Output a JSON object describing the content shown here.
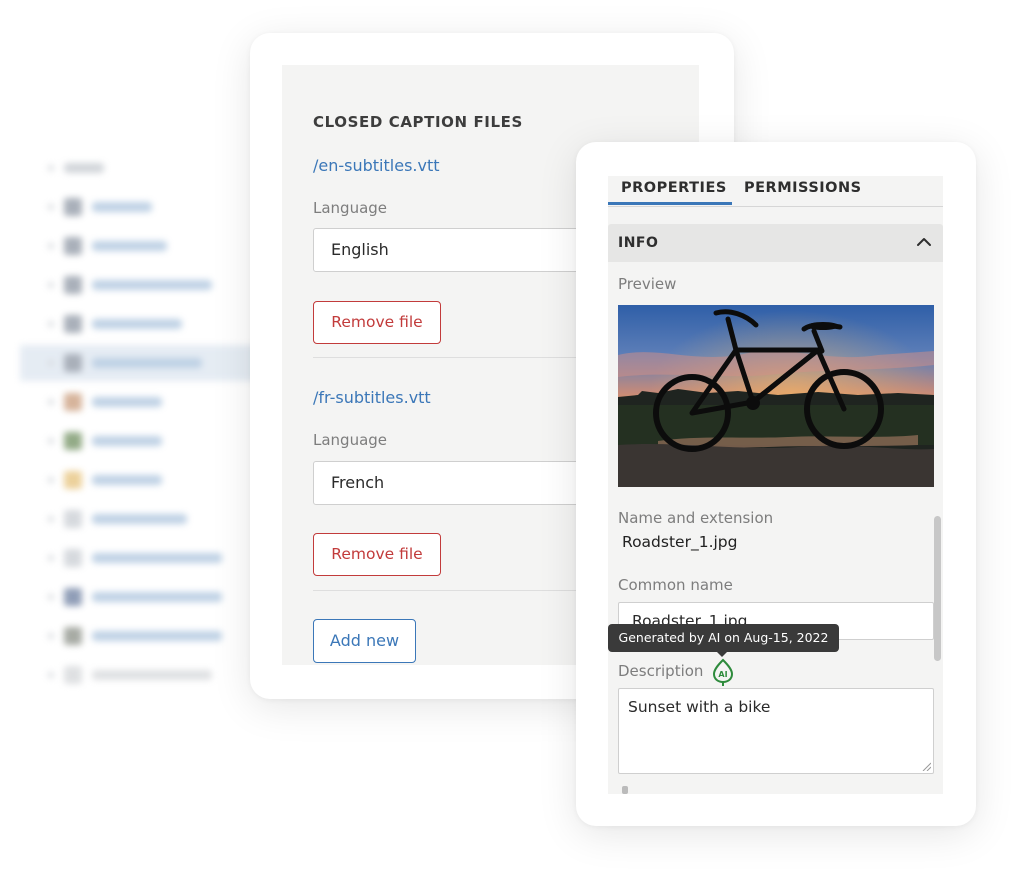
{
  "closed_captions": {
    "title": "CLOSED CAPTION FILES",
    "files": [
      {
        "name": "/en-subtitles.vtt",
        "language_label": "Language",
        "language_value": "English",
        "remove_label": "Remove file"
      },
      {
        "name": "/fr-subtitles.vtt",
        "language_label": "Language",
        "language_value": "French",
        "remove_label": "Remove file"
      }
    ],
    "add_label": "Add new"
  },
  "properties": {
    "tabs": [
      {
        "label": "PROPERTIES",
        "active": true
      },
      {
        "label": "PERMISSIONS",
        "active": false
      }
    ],
    "section": {
      "title": "INFO",
      "expanded": true,
      "icon": "chevron-up-icon"
    },
    "preview": {
      "label": "Preview",
      "image": "bicycle silhouette at sunset"
    },
    "name_extension": {
      "label": "Name and extension",
      "value": "Roadster_1.jpg"
    },
    "common_name": {
      "label": "Common name",
      "value": "Roadster_1.jpg"
    },
    "tooltip": "Generated by AI on Aug-15, 2022",
    "description": {
      "label": "Description",
      "icon": "ai-leaf-icon",
      "icon_text": "AI",
      "value": "Sunset with a bike"
    }
  },
  "colors": {
    "accent_blue": "#3b77b8",
    "remove_red": "#c23b3b",
    "ai_green": "#2e8b3c",
    "panel_bg": "#f4f4f3"
  }
}
